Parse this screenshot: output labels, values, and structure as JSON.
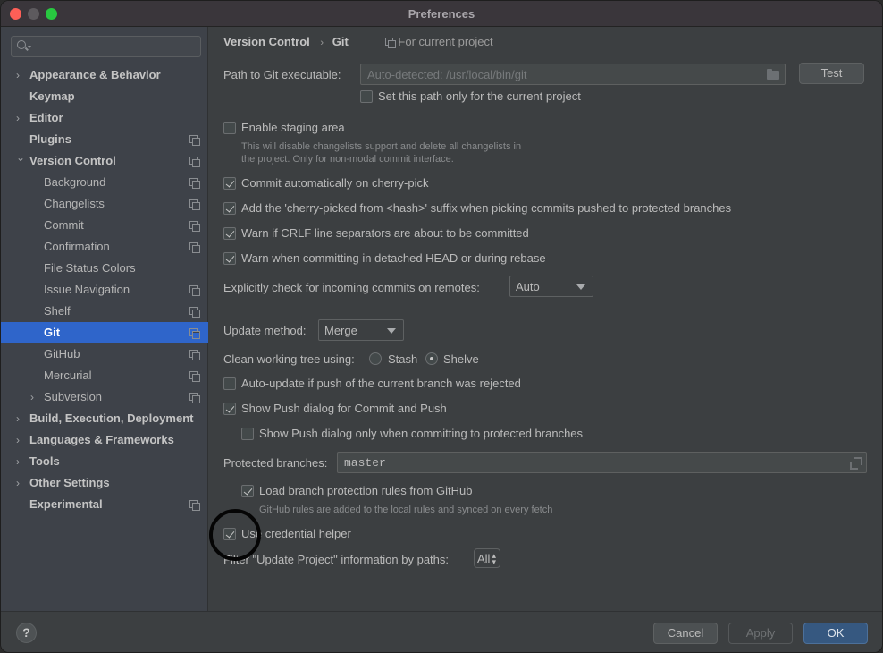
{
  "window": {
    "title": "Preferences"
  },
  "sidebar": {
    "search_placeholder": "",
    "items": [
      {
        "label": "Appearance & Behavior",
        "level": 0,
        "expandable": true,
        "expanded": false,
        "project_scope": false,
        "selected": false
      },
      {
        "label": "Keymap",
        "level": 0,
        "expandable": false,
        "project_scope": false,
        "selected": false
      },
      {
        "label": "Editor",
        "level": 0,
        "expandable": true,
        "expanded": false,
        "project_scope": false,
        "selected": false
      },
      {
        "label": "Plugins",
        "level": 0,
        "expandable": false,
        "project_scope": true,
        "selected": false
      },
      {
        "label": "Version Control",
        "level": 0,
        "expandable": true,
        "expanded": true,
        "project_scope": true,
        "selected": false
      },
      {
        "label": "Background",
        "level": 1,
        "expandable": false,
        "project_scope": true,
        "selected": false
      },
      {
        "label": "Changelists",
        "level": 1,
        "expandable": false,
        "project_scope": true,
        "selected": false
      },
      {
        "label": "Commit",
        "level": 1,
        "expandable": false,
        "project_scope": true,
        "selected": false
      },
      {
        "label": "Confirmation",
        "level": 1,
        "expandable": false,
        "project_scope": true,
        "selected": false
      },
      {
        "label": "File Status Colors",
        "level": 1,
        "expandable": false,
        "project_scope": false,
        "selected": false
      },
      {
        "label": "Issue Navigation",
        "level": 1,
        "expandable": false,
        "project_scope": true,
        "selected": false
      },
      {
        "label": "Shelf",
        "level": 1,
        "expandable": false,
        "project_scope": true,
        "selected": false
      },
      {
        "label": "Git",
        "level": 1,
        "expandable": false,
        "project_scope": true,
        "selected": true
      },
      {
        "label": "GitHub",
        "level": 1,
        "expandable": false,
        "project_scope": true,
        "selected": false
      },
      {
        "label": "Mercurial",
        "level": 1,
        "expandable": false,
        "project_scope": true,
        "selected": false
      },
      {
        "label": "Subversion",
        "level": 1,
        "expandable": true,
        "expanded": false,
        "project_scope": true,
        "selected": false
      },
      {
        "label": "Build, Execution, Deployment",
        "level": 0,
        "expandable": true,
        "expanded": false,
        "project_scope": false,
        "selected": false
      },
      {
        "label": "Languages & Frameworks",
        "level": 0,
        "expandable": true,
        "expanded": false,
        "project_scope": false,
        "selected": false
      },
      {
        "label": "Tools",
        "level": 0,
        "expandable": true,
        "expanded": false,
        "project_scope": false,
        "selected": false
      },
      {
        "label": "Other Settings",
        "level": 0,
        "expandable": true,
        "expanded": false,
        "project_scope": false,
        "selected": false
      },
      {
        "label": "Experimental",
        "level": 0,
        "expandable": false,
        "project_scope": true,
        "selected": false
      }
    ]
  },
  "breadcrumb": {
    "parent": "Version Control",
    "separator": "›",
    "current": "Git",
    "scope_note": "For current project"
  },
  "git": {
    "path_label": "Path to Git executable:",
    "path_placeholder": "Auto-detected: /usr/local/bin/git",
    "test_button": "Test",
    "set_path_only_current": {
      "label": "Set this path only for the current project",
      "checked": false
    },
    "enable_staging": {
      "label": "Enable staging area",
      "checked": false
    },
    "staging_hint_line1": "This will disable changelists support and delete all changelists in",
    "staging_hint_line2": "the project. Only for non-modal commit interface.",
    "commit_on_cherry_pick": {
      "label": "Commit automatically on cherry-pick",
      "checked": true
    },
    "cherry_picked_suffix": {
      "label": "Add the 'cherry-picked from <hash>' suffix when picking commits pushed to protected branches",
      "checked": true
    },
    "warn_crlf": {
      "label": "Warn if CRLF line separators are about to be committed",
      "checked": true
    },
    "warn_detached": {
      "label": "Warn when committing in detached HEAD or during rebase",
      "checked": true
    },
    "incoming_label": "Explicitly check for incoming commits on remotes:",
    "incoming_value": "Auto",
    "update_method_label": "Update method:",
    "update_method_value": "Merge",
    "clean_tree_label": "Clean working tree using:",
    "clean_tree_options": [
      {
        "label": "Stash",
        "selected": false
      },
      {
        "label": "Shelve",
        "selected": true
      }
    ],
    "auto_update_rejected": {
      "label": "Auto-update if push of the current branch was rejected",
      "checked": false
    },
    "show_push_dialog": {
      "label": "Show Push dialog for Commit and Push",
      "checked": true
    },
    "show_push_protected": {
      "label": "Show Push dialog only when committing to protected branches",
      "checked": false
    },
    "protected_branches_label": "Protected branches:",
    "protected_branches_value": "master",
    "load_github_rules": {
      "label": "Load branch protection rules from GitHub",
      "checked": true
    },
    "github_rules_hint": "GitHub rules are added to the local rules and synced on every fetch",
    "credential_helper": {
      "label": "Use credential helper",
      "checked": true
    },
    "filter_label": "Filter \"Update Project\" information by paths:",
    "filter_value": "All"
  },
  "footer": {
    "help_label": "?",
    "cancel": "Cancel",
    "apply": "Apply",
    "ok": "OK"
  },
  "colors": {
    "selection": "#2f65ca",
    "primary_button": "#365880",
    "background": "#3c3f41",
    "sidebar": "#3e4249"
  }
}
